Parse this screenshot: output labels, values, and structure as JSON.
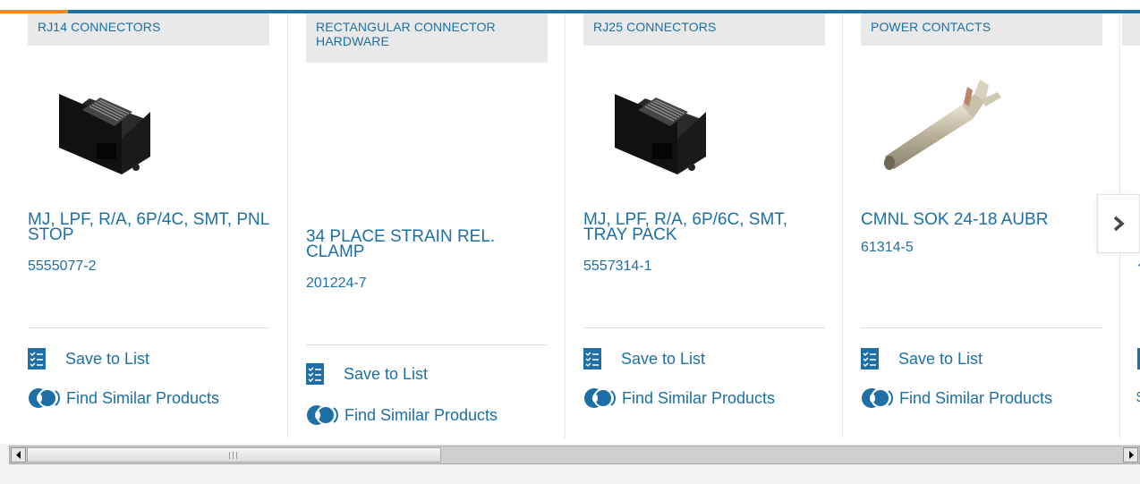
{
  "carousel": {
    "cards": [
      {
        "category": "RJ14 CONNECTORS",
        "title": "MJ, LPF, R/A, 6P/4C, SMT, PNL STOP",
        "part_number": "5555077-2",
        "image": "rj-jack-image"
      },
      {
        "category": "RECTANGULAR CONNECTOR HARDWARE",
        "title": "34 PLACE STRAIN REL. CLAMP",
        "part_number": "201224-7",
        "image": ""
      },
      {
        "category": "RJ25 CONNECTORS",
        "title": "MJ, LPF, R/A, 6P/6C, SMT, TRAY PACK",
        "part_number": "5557314-1",
        "image": "rj-jack-image"
      },
      {
        "category": "POWER CONTACTS",
        "title": "CMNL SOK 24-18 AUBR",
        "part_number": "61314-5",
        "image": "contact-pin-image"
      }
    ],
    "actions": {
      "save_label": "Save to List",
      "similar_label": "Find Similar Products"
    },
    "next_icon": "chevron-right-icon",
    "partial_card": {
      "pn_fragment": "4",
      "action_fragment": "$"
    }
  },
  "scrollbar": {
    "position_fraction": 0.0,
    "visible_fraction": 0.37
  },
  "colors": {
    "accent_blue": "#1d6fa6",
    "accent_orange": "#f28c1e",
    "category_bg": "#e9e9e9"
  }
}
